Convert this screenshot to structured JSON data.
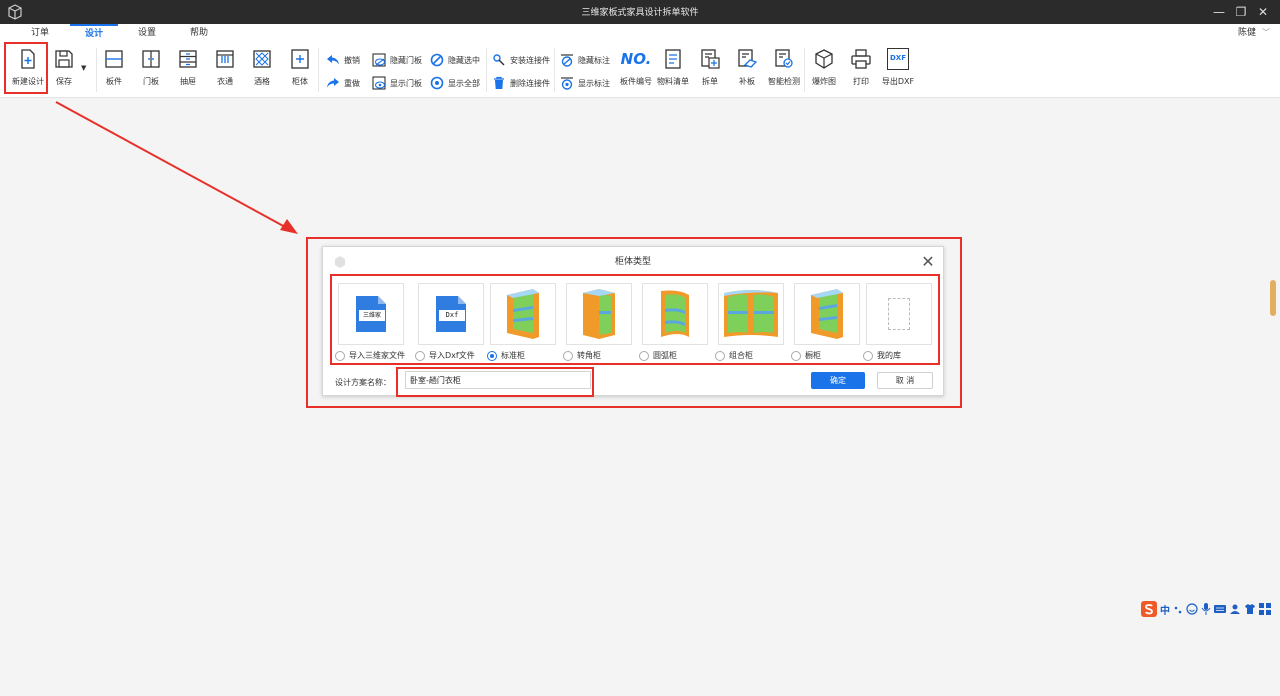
{
  "window": {
    "title": "三维家板式家具设计拆单软件",
    "controls": [
      "—",
      "❐",
      "✕"
    ]
  },
  "tabs": [
    {
      "label": "订单"
    },
    {
      "label": "设计",
      "active": true
    },
    {
      "label": "设置"
    },
    {
      "label": "帮助"
    }
  ],
  "user": {
    "name": "陈健"
  },
  "ribbon": {
    "new_design": "新建设计",
    "save": "保存",
    "panel": "板件",
    "door": "门板",
    "drawer": "抽屉",
    "clothes_rail": "衣通",
    "wine_rack": "酒格",
    "cabinet": "柜体",
    "undo": "撤销",
    "redo": "重做",
    "hide_door": "隐藏门板",
    "show_door": "显示门板",
    "hide_selected": "隐藏选中",
    "show_all": "显示全部",
    "install_connector": "安装连接件",
    "delete_connector": "删除连接件",
    "hide_dimension": "隐藏标注",
    "show_dimension": "显示标注",
    "panel_number_icon": "NO.",
    "panel_number": "板件编号",
    "material_list": "物料清单",
    "split_order": "拆单",
    "patch_panel": "补板",
    "smart_check": "智能检测",
    "exploded_view": "爆炸图",
    "print": "打印",
    "export_dxf_icon": "DXF",
    "export_dxf": "导出DXF"
  },
  "dialog": {
    "title": "柜体类型",
    "options": [
      {
        "label": "导入三维家文件",
        "thumb_text": "三维家",
        "selected": false
      },
      {
        "label": "导入Dxf文件",
        "thumb_text": "Dxf",
        "selected": false
      },
      {
        "label": "标准柜",
        "selected": true
      },
      {
        "label": "转角柜",
        "selected": false
      },
      {
        "label": "圆弧柜",
        "selected": false
      },
      {
        "label": "组合柜",
        "selected": false
      },
      {
        "label": "橱柜",
        "selected": false
      },
      {
        "label": "我的库",
        "selected": false
      }
    ],
    "name_label": "设计方案名称：",
    "name_value": "卧室-趟门衣柜",
    "ok": "确定",
    "cancel": "取 消"
  },
  "ime": {
    "text": "中"
  },
  "colors": {
    "accent": "#1a73e8",
    "annotation": "#e8302a",
    "titlebar": "#2b2b2b"
  }
}
